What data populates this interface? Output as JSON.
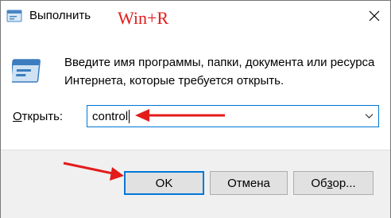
{
  "titlebar": {
    "title": "Выполнить",
    "annotation": "Win+R"
  },
  "dialog": {
    "description": "Введите имя программы, папки, документа или ресурса Интернета, которые требуется открыть.",
    "open_label_prefix": "О",
    "open_label_rest": "ткрыть:",
    "input_value": "control"
  },
  "buttons": {
    "ok": "OK",
    "cancel": "Отмена",
    "browse_prefix": "Об",
    "browse_underlined": "з",
    "browse_suffix": "ор..."
  },
  "colors": {
    "annotation_red": "#e31b1b",
    "focus_blue": "#0078d7",
    "footer_bg": "#f0f0f0"
  },
  "icons": [
    "run-app-icon",
    "close-icon",
    "run-program-icon",
    "chevron-down-icon",
    "annotation-arrow"
  ]
}
